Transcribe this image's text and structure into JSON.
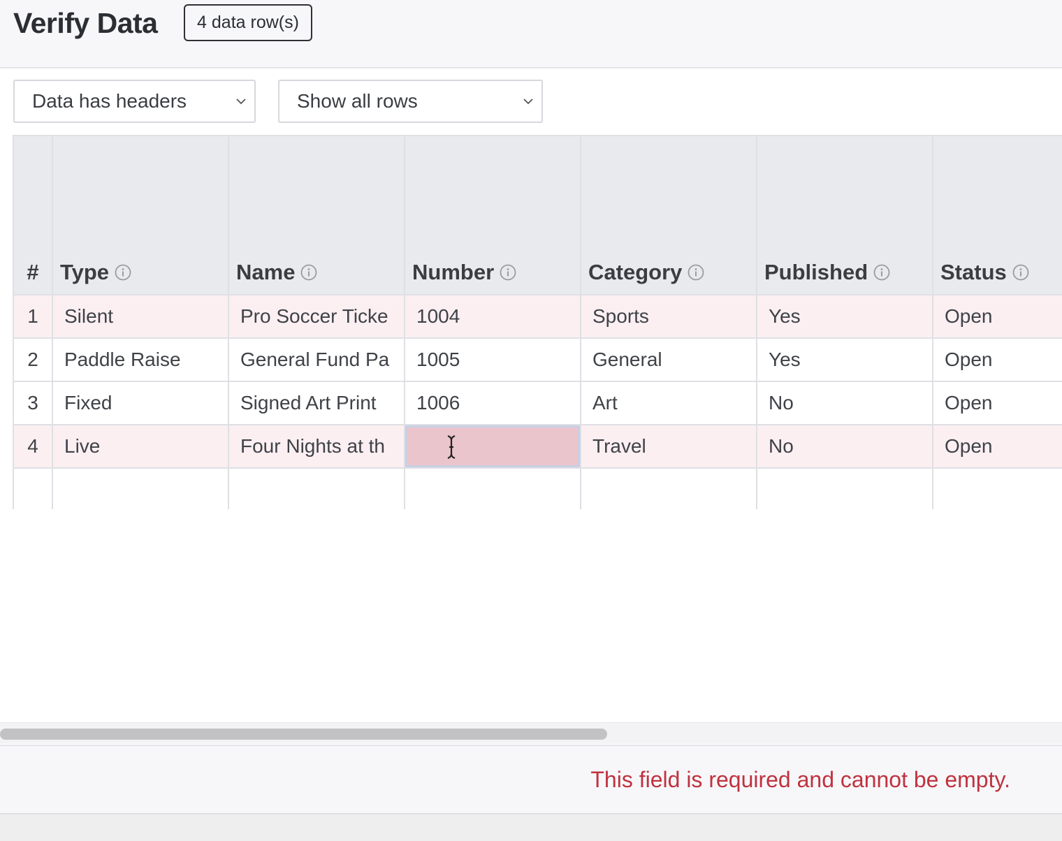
{
  "header": {
    "title": "Verify Data",
    "row_count_badge": "4 data row(s)"
  },
  "controls": {
    "header_option": "Data has headers",
    "row_filter": "Show all rows"
  },
  "table": {
    "columns": [
      {
        "label": "#",
        "info": false
      },
      {
        "label": "Type",
        "info": true
      },
      {
        "label": "Name",
        "info": true
      },
      {
        "label": "Number",
        "info": true
      },
      {
        "label": "Category",
        "info": true
      },
      {
        "label": "Published",
        "info": true
      },
      {
        "label": "Status",
        "info": true
      }
    ],
    "rows": [
      {
        "num": "1",
        "type": "Silent",
        "name": "Pro Soccer Ticke",
        "number": "1004",
        "category": "Sports",
        "published": "Yes",
        "status": "Open",
        "state": "error"
      },
      {
        "num": "2",
        "type": "Paddle Raise",
        "name": "General Fund Pa",
        "number": "1005",
        "category": "General",
        "published": "Yes",
        "status": "Open",
        "state": "ok"
      },
      {
        "num": "3",
        "type": "Fixed",
        "name": "Signed Art Print",
        "number": "1006",
        "category": "Art",
        "published": "No",
        "status": "Open",
        "state": "ok"
      },
      {
        "num": "4",
        "type": "Live",
        "name": "Four Nights at th",
        "number": "",
        "category": "Travel",
        "published": "No",
        "status": "Open",
        "state": "error"
      }
    ]
  },
  "validation": {
    "message": "This field is required and cannot be empty."
  },
  "icons": {
    "info": "info-circle-icon",
    "dropdown": "chevron-down-icon",
    "cursor": "text-cursor-icon"
  },
  "colors": {
    "error_text": "#c0323f",
    "error_row": "#fbeff2",
    "invalid_cell": "#ebc5cc",
    "header_bg": "#e9eaee"
  }
}
